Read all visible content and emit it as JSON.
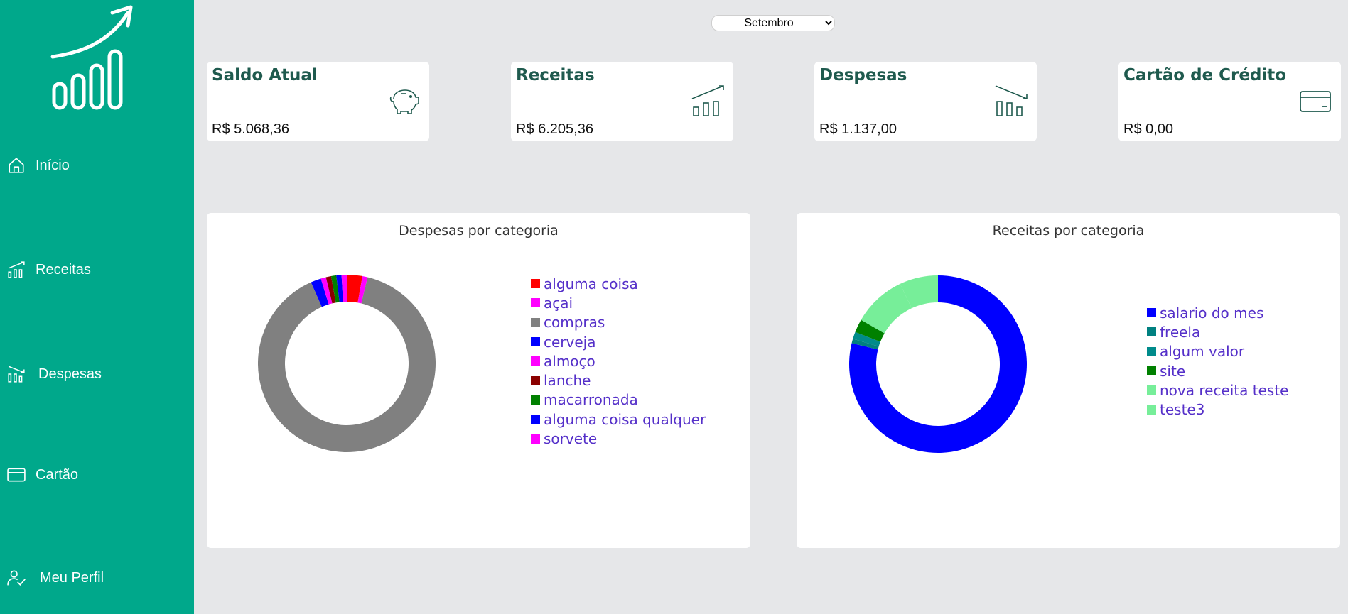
{
  "sidebar": {
    "items": [
      {
        "label": "Início",
        "icon": "home-icon"
      },
      {
        "label": "Receitas",
        "icon": "bar-chart-up-icon"
      },
      {
        "label": "Despesas",
        "icon": "bar-chart-down-icon"
      },
      {
        "label": "Cartão",
        "icon": "credit-card-icon"
      },
      {
        "label": "Meu Perfil",
        "icon": "user-check-icon"
      }
    ]
  },
  "month_selector": {
    "selected": "Setembro"
  },
  "cards": [
    {
      "title": "Saldo Atual",
      "value": "R$ 5.068,36",
      "icon": "piggy-bank-icon"
    },
    {
      "title": "Receitas",
      "value": "R$ 6.205,36",
      "icon": "bar-chart-up-icon"
    },
    {
      "title": "Despesas",
      "value": "R$ 1.137,00",
      "icon": "bar-chart-down-icon"
    },
    {
      "title": "Cartão de Crédito",
      "value": "R$ 0,00",
      "icon": "credit-card-icon"
    }
  ],
  "colors": {
    "sidebar": "#00a88b",
    "card_title": "#1f5a4e",
    "legend_text": "#5530c9",
    "background": "#e6e7e9"
  },
  "chart_data": [
    {
      "type": "pie",
      "title": "Despesas por categoria",
      "donut": true,
      "legend_position": "right",
      "categories": [
        "alguma coisa",
        "açai",
        "compras",
        "cerveja",
        "almoço",
        "lanche",
        "macarronada",
        "alguma coisa qualquer",
        "sorvete"
      ],
      "values": [
        30,
        10,
        950,
        20,
        10,
        10,
        10,
        10,
        10
      ],
      "colors": [
        "#ff0000",
        "#ff00ff",
        "#808080",
        "#0000ff",
        "#ff00ff",
        "#8b0000",
        "#008000",
        "#0000ff",
        "#ff00ff"
      ]
    },
    {
      "type": "pie",
      "title": "Receitas por categoria",
      "donut": true,
      "legend_position": "right",
      "categories": [
        "salario do mes",
        "freela",
        "algum valor",
        "site",
        "nova receita teste",
        "teste3"
      ],
      "values": [
        4890,
        50,
        80,
        150,
        600,
        435
      ],
      "colors": [
        "#0000ff",
        "#008080",
        "#008b8b",
        "#008000",
        "#77ee99",
        "#77ee99"
      ]
    }
  ]
}
